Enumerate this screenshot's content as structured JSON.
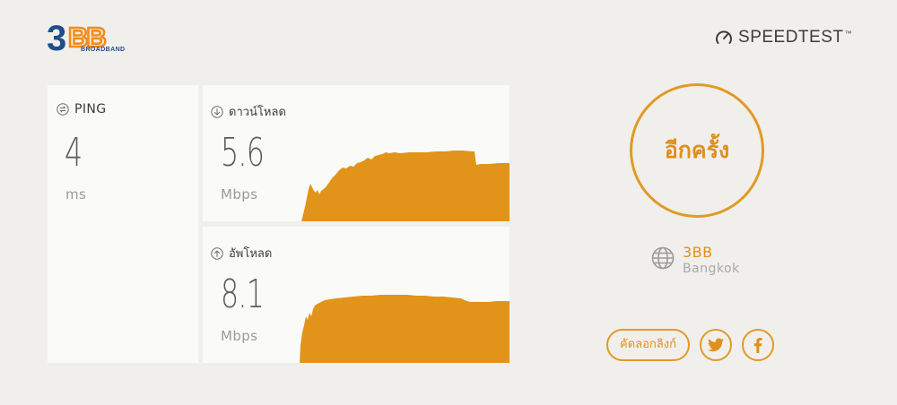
{
  "header": {
    "logo_text": "3BB",
    "logo_subtext": "BROADBAND",
    "brand_text": "SPEEDTEST",
    "brand_tm": "™",
    "brand_icon": "gauge-icon"
  },
  "colors": {
    "accent": "#e19a24",
    "logo_blue": "#1f4e8c",
    "logo_orange": "#f28c1c",
    "background": "#f1efeb"
  },
  "ping": {
    "label": "PING",
    "value": "4",
    "unit": "ms",
    "icon": "ping-icon"
  },
  "download": {
    "label": "ดาวน์โหลด",
    "value": "5.6",
    "unit": "Mbps",
    "icon": "download-arrow-icon"
  },
  "upload": {
    "label": "อัพโหลด",
    "value": "8.1",
    "unit": "Mbps",
    "icon": "upload-arrow-icon"
  },
  "again_label": "อีกครั้ง",
  "server": {
    "isp": "3BB",
    "city": "Bangkok",
    "icon": "globe-icon"
  },
  "share": {
    "copy_link_label": "คัดลอกลิงก์",
    "twitter_icon": "twitter-icon",
    "facebook_icon": "facebook-icon"
  }
}
